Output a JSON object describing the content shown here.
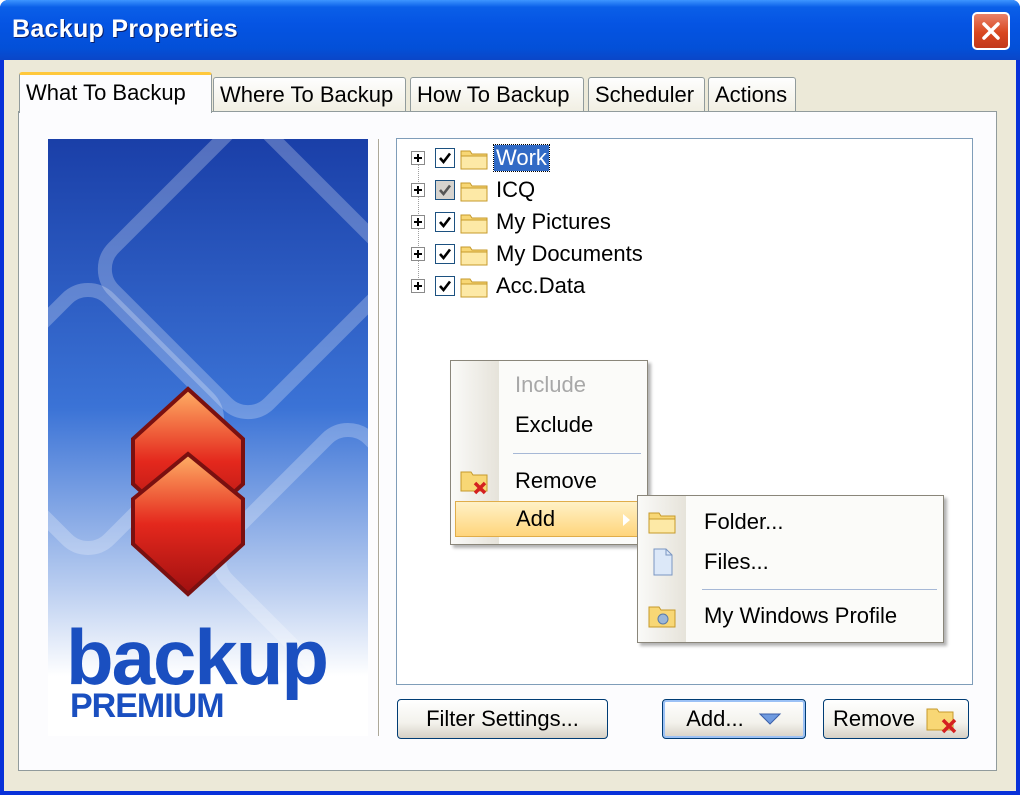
{
  "window": {
    "title": "Backup Properties",
    "close_icon": "close-icon"
  },
  "tabs": [
    {
      "label": "What To Backup",
      "active": true
    },
    {
      "label": "Where To Backup",
      "active": false
    },
    {
      "label": "How To Backup",
      "active": false
    },
    {
      "label": "Scheduler",
      "active": false
    },
    {
      "label": "Actions",
      "active": false
    }
  ],
  "banner": {
    "logo_line1": "backup",
    "logo_line2": "PREMIUM"
  },
  "tree": {
    "items": [
      {
        "label": "Work",
        "checked": true,
        "grey": false,
        "selected": true
      },
      {
        "label": "ICQ",
        "checked": true,
        "grey": true,
        "selected": false
      },
      {
        "label": "My Pictures",
        "checked": true,
        "grey": false,
        "selected": false
      },
      {
        "label": "My Documents",
        "checked": true,
        "grey": false,
        "selected": false
      },
      {
        "label": "Acc.Data",
        "checked": true,
        "grey": false,
        "selected": false
      }
    ]
  },
  "context_menu": {
    "include": "Include",
    "exclude": "Exclude",
    "remove": "Remove",
    "add": "Add"
  },
  "submenu": {
    "folder": "Folder...",
    "files": "Files...",
    "profile": "My Windows Profile"
  },
  "buttons": {
    "filter_settings": "Filter Settings...",
    "add": "Add...",
    "remove": "Remove"
  },
  "colors": {
    "title_bar": "#0554e3",
    "selection": "#316ac5",
    "menu_highlight": "#ffd57c",
    "logo_blue": "#1a4fc0"
  }
}
